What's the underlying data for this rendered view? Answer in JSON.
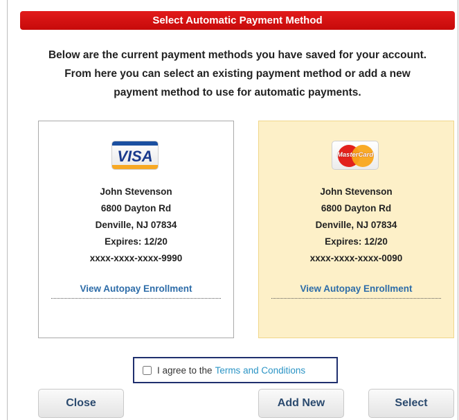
{
  "dialog": {
    "title": "Select Automatic Payment Method",
    "intro_lines": [
      "Below are the current payment methods you have saved for your account.",
      "From here you can select an existing payment method or add a new",
      "payment method to use for automatic payments."
    ]
  },
  "cards": [
    {
      "brand": "VISA",
      "icon": "visa-logo",
      "name": "John Stevenson",
      "address1": "6800 Dayton Rd",
      "address2": "Denville, NJ 07834",
      "expires": "Expires: 12/20",
      "number": "xxxx-xxxx-xxxx-9990",
      "link": "View Autopay Enrollment",
      "selected": false
    },
    {
      "brand": "MasterCard",
      "icon": "mastercard-logo",
      "name": "John Stevenson",
      "address1": "6800 Dayton Rd",
      "address2": "Denville, NJ 07834",
      "expires": "Expires: 12/20",
      "number": "xxxx-xxxx-xxxx-0090",
      "link": "View Autopay Enrollment",
      "selected": true
    }
  ],
  "agreement": {
    "prefix": "I agree to the",
    "terms_link": "Terms and Conditions",
    "checked": false
  },
  "buttons": {
    "close": "Close",
    "add_new": "Add New",
    "select": "Select"
  },
  "colors": {
    "title_bar": "#d41010",
    "selected_card": "#fdf0c8",
    "link": "#2d6ca8",
    "terms_link": "#2b94c5"
  }
}
